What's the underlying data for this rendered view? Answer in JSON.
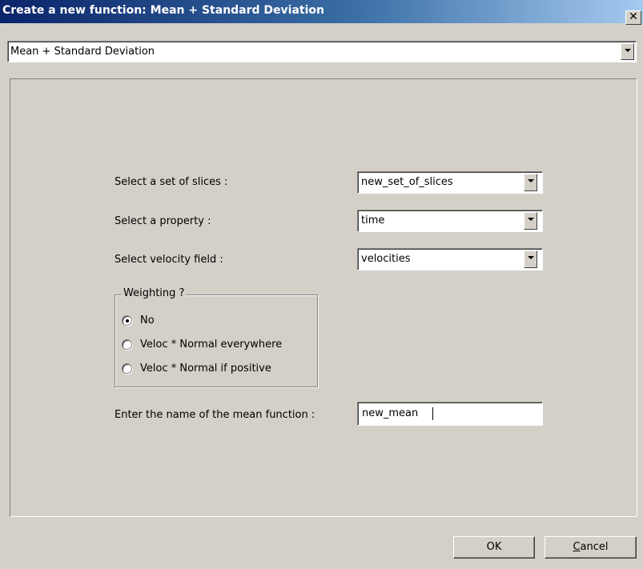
{
  "window": {
    "title": "Create a new function: Mean + Standard Deviation",
    "close_glyph": "✕"
  },
  "function_selector": {
    "selected": "Mean + Standard Deviation"
  },
  "form": {
    "slices": {
      "label": "Select a set of slices :",
      "value": "new_set_of_slices"
    },
    "property": {
      "label": "Select a property :",
      "value": "time"
    },
    "velocity": {
      "label": "Select velocity field :",
      "value": "velocities"
    },
    "weighting": {
      "legend": "Weighting ?",
      "options": [
        {
          "label": "No",
          "selected": true
        },
        {
          "label": "Veloc * Normal everywhere",
          "selected": false
        },
        {
          "label": "Veloc * Normal if positive",
          "selected": false
        }
      ]
    },
    "mean_name": {
      "label": "Enter the name of the mean function :",
      "value": "new_mean"
    }
  },
  "buttons": {
    "ok": "OK",
    "cancel": "Cancel"
  },
  "icons": {
    "dropdown": "chevron-down-icon",
    "close": "close-icon",
    "radio_selected": "radio-dot-icon"
  },
  "colors": {
    "titlebar_start": "#0a246a",
    "titlebar_end": "#a6caf0",
    "face": "#d4d0c8"
  }
}
